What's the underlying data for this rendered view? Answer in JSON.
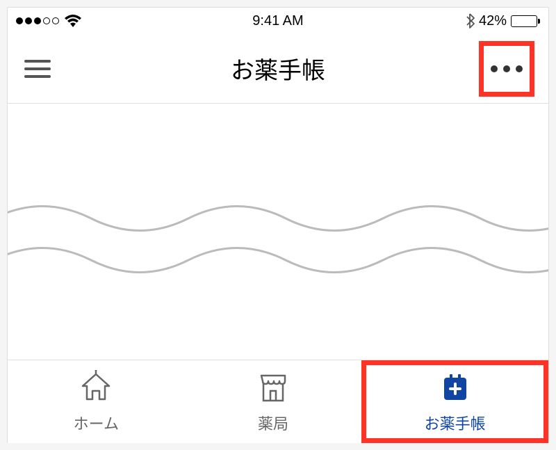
{
  "status_bar": {
    "time": "9:41 AM",
    "bluetooth_visible": true,
    "battery_percent": "42%"
  },
  "nav": {
    "title": "お薬手帳"
  },
  "tabs": {
    "home": {
      "label": "ホーム"
    },
    "pharmacy": {
      "label": "薬局"
    },
    "notebook": {
      "label": "お薬手帳"
    }
  },
  "colors": {
    "highlight": "#ff3226",
    "active": "#1145a5"
  }
}
